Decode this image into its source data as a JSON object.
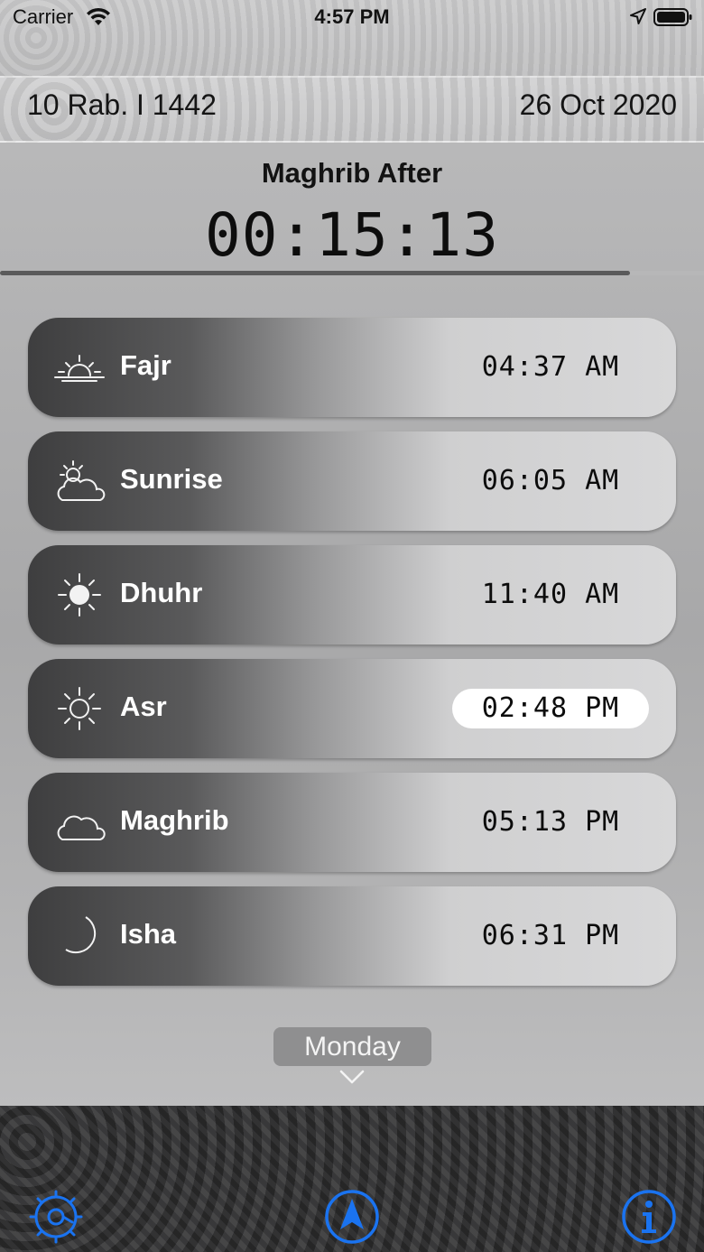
{
  "status_bar": {
    "carrier": "Carrier",
    "time": "4:57 PM"
  },
  "dates": {
    "hijri": "10 Rab. I 1442",
    "gregorian": "26 Oct 2020"
  },
  "countdown": {
    "label": "Maghrib After",
    "value": "00:15:13",
    "progress": 0.895
  },
  "prayers": [
    {
      "name": "Fajr",
      "time": "04:37 AM",
      "icon": "sunrise-icon",
      "active": false
    },
    {
      "name": "Sunrise",
      "time": "06:05 AM",
      "icon": "partly-cloudy-icon",
      "active": false
    },
    {
      "name": "Dhuhr",
      "time": "11:40 AM",
      "icon": "sun-icon",
      "active": false
    },
    {
      "name": "Asr",
      "time": "02:48 PM",
      "icon": "sun-outline-icon",
      "active": true
    },
    {
      "name": "Maghrib",
      "time": "05:13 PM",
      "icon": "cloud-icon",
      "active": false
    },
    {
      "name": "Isha",
      "time": "06:31 PM",
      "icon": "moon-icon",
      "active": false
    }
  ],
  "day_selector": {
    "label": "Monday"
  },
  "colors": {
    "accent_blue": "#1a73f0",
    "active_time_bg": "#ffffff"
  }
}
